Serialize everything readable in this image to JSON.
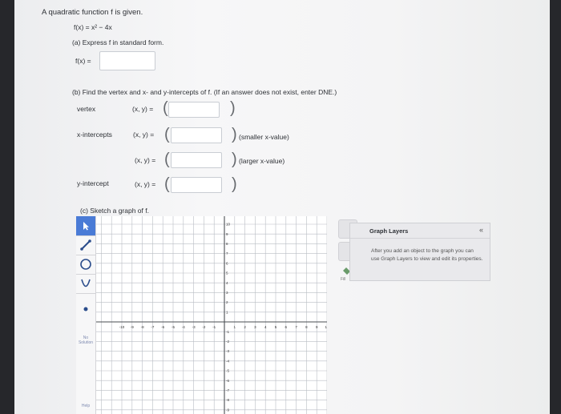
{
  "question": {
    "intro": "A quadratic function f is given.",
    "function": "f(x) = x² − 4x",
    "part_a": "(a) Express f in standard form.",
    "fx_label": "f(x) =",
    "part_b": "(b) Find the vertex and x- and y-intercepts of f. (If an answer does not exist, enter DNE.)",
    "vertex_label": "vertex",
    "xy_label": "(x, y) =",
    "x_intercepts_label": "x-intercepts",
    "smaller_note": "(smaller x-value)",
    "larger_note": "(larger x-value)",
    "y_intercept_label": "y-intercept",
    "part_c": "(c) Sketch a graph of f."
  },
  "graph": {
    "x_ticks": [
      "-10",
      "-9",
      "-8",
      "-7",
      "-6",
      "-5",
      "-4",
      "-3",
      "-2",
      "-1",
      "1",
      "2",
      "3",
      "4",
      "5",
      "6",
      "7",
      "8",
      "9",
      "10"
    ],
    "y_ticks_pos": [
      "10",
      "9",
      "8",
      "7",
      "6",
      "5",
      "4",
      "3",
      "2",
      "1"
    ],
    "y_ticks_neg": [
      "-1",
      "-2",
      "-3",
      "-4",
      "-5",
      "-6",
      "-7",
      "-8",
      "-9",
      "-10"
    ]
  },
  "tools": {
    "no_solution_label": "No Solution",
    "help_label": "Help",
    "fill_label": "Fill"
  },
  "layers_panel": {
    "title": "Graph Layers",
    "collapse": "«",
    "body": "After you add an object to the graph you can use Graph Layers to view and edit its properties."
  },
  "colors": {
    "grid": "#b9bdc4",
    "axis": "#4a4d52",
    "accent": "#5a7fc0"
  }
}
